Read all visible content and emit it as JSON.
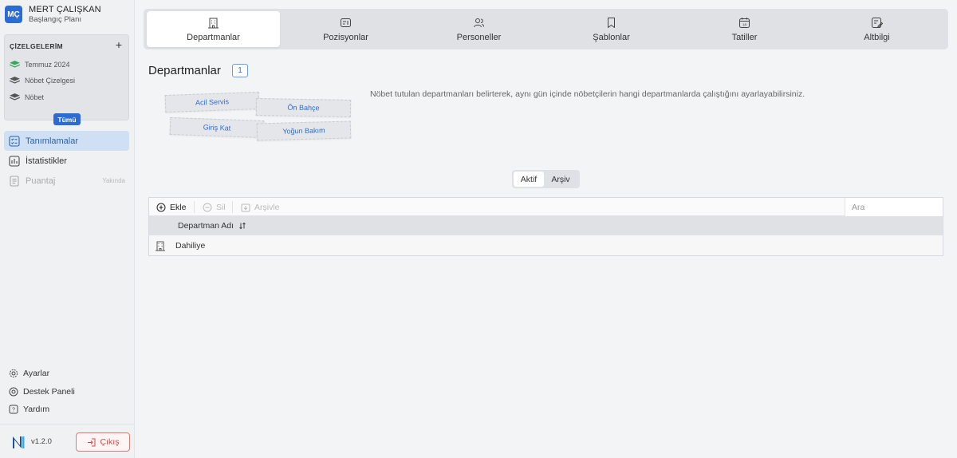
{
  "user": {
    "initials": "MÇ",
    "name": "MERT ÇALIŞKAN",
    "plan": "Başlangıç Planı"
  },
  "schedules": {
    "heading": "ÇİZELGELERİM",
    "add_icon": "plus-icon",
    "items": [
      {
        "label": "Temmuz 2024",
        "color": "#3aa65a"
      },
      {
        "label": "Nöbet Çizelgesi",
        "color": "#555555"
      },
      {
        "label": "Nöbet",
        "color": "#555555"
      }
    ],
    "all_button": "Tümü"
  },
  "nav": {
    "items": [
      {
        "label": "Tanımlamalar",
        "icon": "checklist-icon",
        "active": true
      },
      {
        "label": "İstatistikler",
        "icon": "bar-chart-icon",
        "active": false
      },
      {
        "label": "Puantaj",
        "icon": "document-icon",
        "active": false,
        "badge": "Yakında"
      }
    ]
  },
  "bottom_nav": {
    "items": [
      {
        "label": "Ayarlar",
        "icon": "gear-icon"
      },
      {
        "label": "Destek Paneli",
        "icon": "support-icon"
      },
      {
        "label": "Yardım",
        "icon": "help-icon"
      }
    ],
    "version": "v1.2.0",
    "logout_label": "Çıkış"
  },
  "tabs": [
    {
      "label": "Departmanlar",
      "icon": "building-icon",
      "active": true
    },
    {
      "label": "Pozisyonlar",
      "icon": "id-card-icon",
      "active": false
    },
    {
      "label": "Personeller",
      "icon": "users-icon",
      "active": false
    },
    {
      "label": "Şablonlar",
      "icon": "bookmark-icon",
      "active": false
    },
    {
      "label": "Tatiller",
      "icon": "calendar-icon",
      "active": false
    },
    {
      "label": "Altbilgi",
      "icon": "edit-note-icon",
      "active": false
    }
  ],
  "main": {
    "title": "Departmanlar",
    "count": "1",
    "description": "Nöbet tutulan departmanları belirterek, aynı gün içinde nöbetçilerin hangi departmanlarda çalıştığını ayarlayabilirsiniz.",
    "illustration_cards": [
      "Acil Servis",
      "Ön Bahçe",
      "Giriş Kat",
      "Yoğun Bakım"
    ],
    "toggle": {
      "active": "Aktif",
      "inactive": "Arşiv"
    },
    "toolbar": {
      "add": "Ekle",
      "delete": "Sil",
      "archive": "Arşivle",
      "search_placeholder": "Ara"
    },
    "table": {
      "column": "Departman Adı",
      "rows": [
        {
          "name": "Dahiliye"
        }
      ]
    }
  }
}
